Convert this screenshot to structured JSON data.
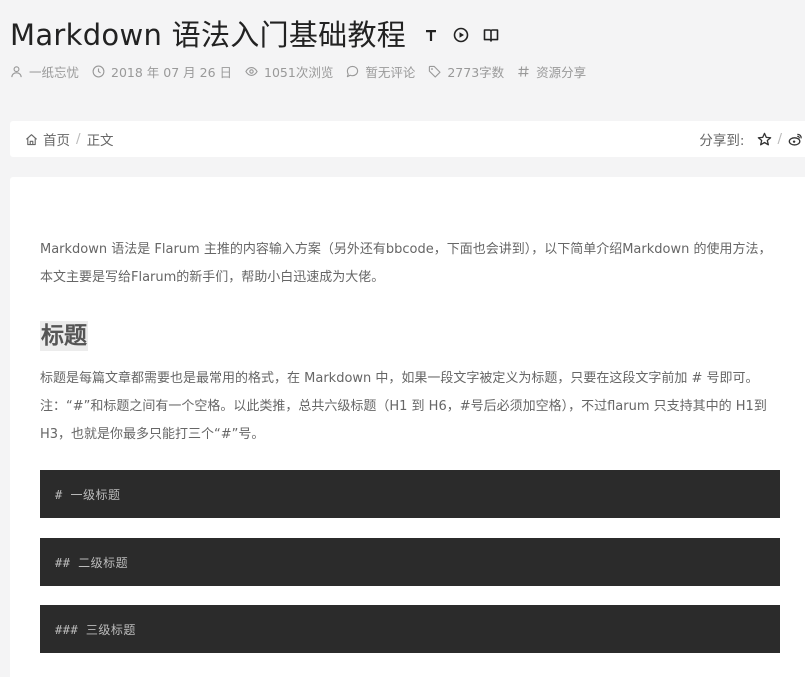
{
  "post": {
    "title": "Markdown 语法入门基础教程"
  },
  "title_tools": [
    "text-size-icon",
    "play-icon",
    "book-icon"
  ],
  "meta": {
    "author": "一纸忘忧",
    "date": "2018 年 07 月 26 日",
    "views": "1051次浏览",
    "comments": "暂无评论",
    "word_count": "2773字数",
    "category": "资源分享"
  },
  "breadcrumb": {
    "home": "首页",
    "separator": "/",
    "current": "正文"
  },
  "share": {
    "label": "分享到:",
    "separator": "/",
    "targets": [
      "qq-icon",
      "weibo-icon"
    ]
  },
  "content": {
    "intro": "Markdown 语法是 Flarum 主推的内容输入方案（另外还有bbcode，下面也会讲到），以下简单介绍Markdown 的使用方法，本文主要是写给Flarum的新手们，帮助小白迅速成为大佬。",
    "heading": "标题",
    "body": "标题是每篇文章都需要也是最常用的格式，在 Markdown 中，如果一段文字被定义为标题，只要在这段文字前加 # 号即可。注：“#”和标题之间有一个空格。以此类推，总共六级标题（H1 到 H6，#号后必须加空格），不过flarum 只支持其中的 H1到 H3，也就是你最多只能打三个“#”号。",
    "code_blocks": [
      "# 一级标题",
      "## 二级标题",
      "### 三级标题"
    ]
  },
  "colors": {
    "page_bg": "#f4f4f5",
    "card_bg": "#ffffff",
    "code_bg": "#2b2b2b",
    "muted_text": "#999999"
  }
}
